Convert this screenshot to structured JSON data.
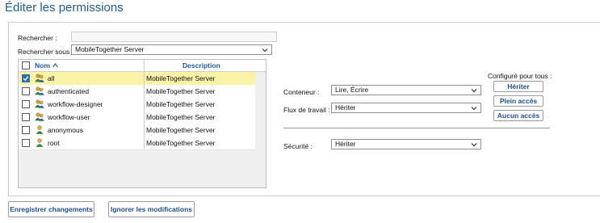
{
  "page": {
    "title": "Éditer les permissions"
  },
  "search": {
    "label": "Rechercher :",
    "value": ""
  },
  "search_under": {
    "label": "Rechercher sous :",
    "value": "MobileTogether Server"
  },
  "table": {
    "columns": {
      "name": "Nom",
      "description": "Description"
    },
    "rows": [
      {
        "name": "all",
        "description": "MobileTogether Server",
        "checked": true,
        "selected": true,
        "icon": "user-group-icon"
      },
      {
        "name": "authenticated",
        "description": "MobileTogether Server",
        "checked": false,
        "selected": false,
        "icon": "user-group-icon"
      },
      {
        "name": "workflow-designer",
        "description": "MobileTogether Server",
        "checked": false,
        "selected": false,
        "icon": "user-group-icon"
      },
      {
        "name": "workflow-user",
        "description": "MobileTogether Server",
        "checked": false,
        "selected": false,
        "icon": "user-group-icon"
      },
      {
        "name": "anonymous",
        "description": "MobileTogether Server",
        "checked": false,
        "selected": false,
        "icon": "user-icon"
      },
      {
        "name": "root",
        "description": "MobileTogether Server",
        "checked": false,
        "selected": false,
        "icon": "user-icon"
      }
    ]
  },
  "permissions": {
    "container": {
      "label": "Conteneur :",
      "value": "Lire, Écrire"
    },
    "workflow": {
      "label": "Flux de travail :",
      "value": "Hériter"
    },
    "security": {
      "label": "Sécurité :",
      "value": "Hériter"
    }
  },
  "configure_all": {
    "label": "Configuré pour tous :",
    "inherit": "Hériter",
    "full_access": "Plein accès",
    "no_access": "Aucun accès"
  },
  "footer": {
    "save": "Enregistrer changements",
    "discard": "Ignorer les modifications"
  },
  "colors": {
    "accent": "#1f5d8f",
    "selected_row": "#fbf3a8",
    "button_text": "#1f4f86"
  }
}
